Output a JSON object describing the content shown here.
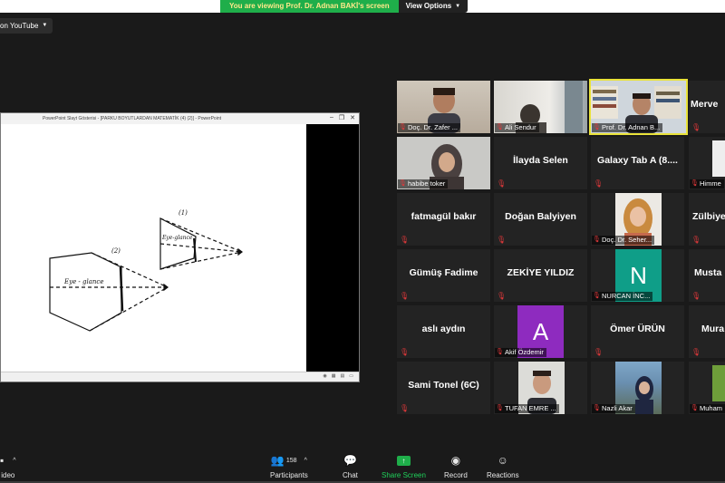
{
  "banner": {
    "message": "You are viewing Prof. Dr. Adnan BAKİ's screen",
    "options": "View Options"
  },
  "live": {
    "label": "on YouTube"
  },
  "ppt": {
    "title": "PowerPoint Slayt Gösterisi - [PARKU BOYUTLARDAN MATEMATİK (4) (2)] - PowerPoint",
    "fig1_label": "(1)",
    "fig2_label": "(2)",
    "eye_glance_1": "Eye-glance",
    "eye_glance_2": "Eye - glance"
  },
  "gallery": {
    "tiles": [
      {
        "label": "Doç. Dr. Zafer ..."
      },
      {
        "label": "Ali Sendur"
      },
      {
        "label": "Prof. Dr. Adnan B..."
      },
      {
        "label": "Merve"
      },
      {
        "label": "habibe toker"
      },
      {
        "label": "İlayda Selen"
      },
      {
        "label": "Galaxy Tab A (8...."
      },
      {
        "label": "Himme"
      },
      {
        "label": "fatmagül bakır"
      },
      {
        "label": "Doğan Balyiyen"
      },
      {
        "label": "Doç. Dr. Seher..."
      },
      {
        "label": "Zülbiye"
      },
      {
        "label": "Gümüş Fadime"
      },
      {
        "label": "ZEKİYE YILDIZ"
      },
      {
        "label": "NURCAN İNC...",
        "initial": "N"
      },
      {
        "label": "Musta"
      },
      {
        "label": "aslı aydın"
      },
      {
        "label": "Akif Özdemir",
        "initial": "A"
      },
      {
        "label": "Ömer ÜRÜN"
      },
      {
        "label": "Mura"
      },
      {
        "label": "Sami Tonel (6C)"
      },
      {
        "label": "TUFAN EMRE ..."
      },
      {
        "label": "Nazli Akar"
      },
      {
        "label": "Muham"
      }
    ]
  },
  "toolbar": {
    "video": "ideo",
    "participants": "Participants",
    "participants_count": "158",
    "chat": "Chat",
    "share": "Share Screen",
    "record": "Record",
    "reactions": "Reactions"
  },
  "colors": {
    "share_green": "#1fae4a",
    "active_border": "#e9e23a",
    "mic_red": "#e0383a",
    "nurcan_avatar": "#0f9e88",
    "akif_avatar": "#8e2bbf"
  }
}
